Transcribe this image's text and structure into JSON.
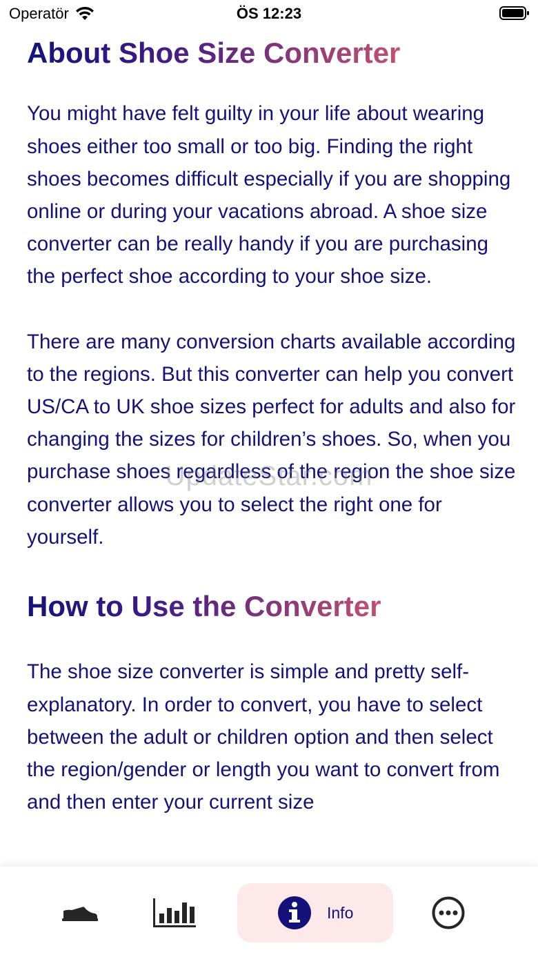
{
  "status_bar": {
    "carrier": "Operatör",
    "time": "ÖS 12:23"
  },
  "sections": {
    "about_heading": "About Shoe Size Converter",
    "about_p1": "You might have felt guilty in your life about wearing shoes either too small or too big. Finding the right shoes becomes difficult especially if you are shopping online or during your vacations abroad. A shoe size converter can be really handy if you are purchasing the perfect shoe according to your shoe size.",
    "about_p2": "There are many conversion charts available according to the regions. But this converter can help you convert US/CA to UK shoe sizes perfect for adults and also for changing the sizes for children’s shoes. So, when you purchase shoes regardless of the region the shoe size converter allows you to select the right one for yourself.",
    "howto_heading": "How to Use the Converter",
    "howto_p1": "The shoe size converter is simple and pretty self-explanatory. In order to convert, you have to select between the adult or children option and then select the region/gender or length you want to convert from and then enter your current size"
  },
  "watermark": "UpdateStar.com",
  "tab_bar": {
    "tabs": [
      {
        "icon": "shoe-icon",
        "label": ""
      },
      {
        "icon": "chart-icon",
        "label": ""
      },
      {
        "icon": "info-icon",
        "label": "Info",
        "selected": true
      },
      {
        "icon": "more-icon",
        "label": ""
      }
    ],
    "selected_bg": "#fde8ea",
    "accent": "#14127a"
  }
}
